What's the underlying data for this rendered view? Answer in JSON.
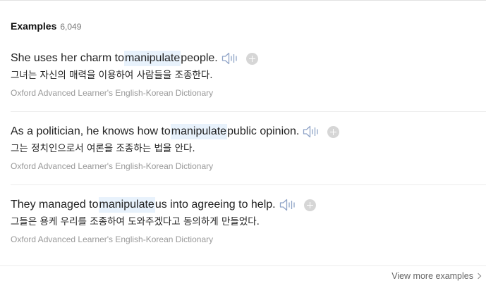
{
  "section": {
    "title": "Examples",
    "count": "6,049"
  },
  "examples": [
    {
      "before": "She uses her charm to ",
      "keyword": "manipulate",
      "after": " people.",
      "translation": "그녀는 자신의 매력을 이용하여 사람들을 조종한다.",
      "source": "Oxford Advanced Learner's English-Korean Dictionary"
    },
    {
      "before": "As a politician, he knows how to ",
      "keyword": "manipulate",
      "after": " public opinion.",
      "translation": "그는 정치인으로서 여론을 조종하는 법을 안다.",
      "source": "Oxford Advanced Learner's English-Korean Dictionary"
    },
    {
      "before": "They managed to ",
      "keyword": "manipulate",
      "after": " us into agreeing to help.",
      "translation": "그들은 용케 우리를 조종하여 도와주겠다고 동의하게 만들었다.",
      "source": "Oxford Advanced Learner's English-Korean Dictionary"
    }
  ],
  "footer": {
    "view_more_label": "View more examples"
  },
  "icons": {
    "speaker": "speaker-icon",
    "add": "plus-circle-icon",
    "chevron": "chevron-right-icon"
  },
  "colors": {
    "highlight": "#e8f2fc",
    "speaker": "#8fa3c7",
    "plus_bg": "#d6d6d6"
  }
}
